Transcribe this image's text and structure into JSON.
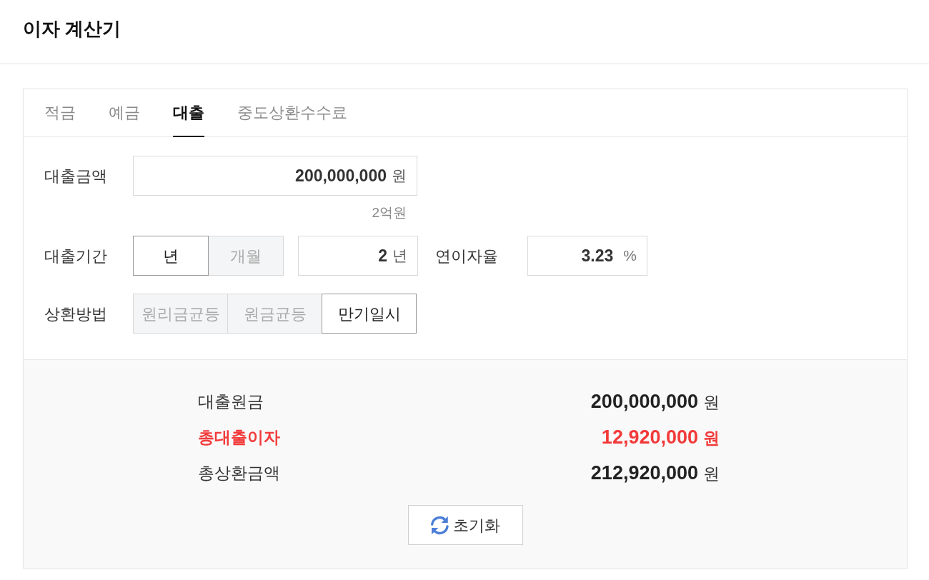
{
  "title": "이자 계산기",
  "tabs": [
    {
      "label": "적금",
      "selected": false
    },
    {
      "label": "예금",
      "selected": false
    },
    {
      "label": "대출",
      "selected": true
    },
    {
      "label": "중도상환수수료",
      "selected": false
    }
  ],
  "form": {
    "loan_amount": {
      "label": "대출금액",
      "value": "200,000,000",
      "unit": "원",
      "hint": "2억원"
    },
    "period": {
      "label": "대출기간",
      "units": [
        {
          "label": "년",
          "selected": true
        },
        {
          "label": "개월",
          "selected": false
        }
      ],
      "value": "2",
      "unit": "년"
    },
    "rate": {
      "label": "연이자율",
      "value": "3.23",
      "unit": "%"
    },
    "repayment": {
      "label": "상환방법",
      "options": [
        {
          "label": "원리금균등",
          "selected": false
        },
        {
          "label": "원금균등",
          "selected": false
        },
        {
          "label": "만기일시",
          "selected": true
        }
      ]
    }
  },
  "results": [
    {
      "label": "대출원금",
      "value": "200,000,000",
      "unit": "원",
      "highlight": false
    },
    {
      "label": "총대출이자",
      "value": "12,920,000",
      "unit": "원",
      "highlight": true
    },
    {
      "label": "총상환금액",
      "value": "212,920,000",
      "unit": "원",
      "highlight": false
    }
  ],
  "reset_button": {
    "label": "초기화"
  }
}
